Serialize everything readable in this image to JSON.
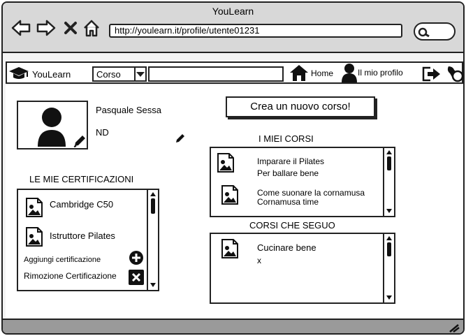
{
  "browser": {
    "title": "YouLearn",
    "url": "http://youlearn.it/profile/utente01231"
  },
  "appbar": {
    "brand": "YouLearn",
    "select_value": "Corso",
    "home_label": "Home",
    "profile_label": "Il mio profilo"
  },
  "profile": {
    "name": "Pasquale Sessa",
    "info": "ND"
  },
  "certifications": {
    "heading": "LE MIE CERTIFICAZIONI",
    "items": [
      {
        "label": "Cambridge C50"
      },
      {
        "label": "Istruttore Pilates"
      }
    ],
    "add_label": "Aggiungi certificazione",
    "remove_label": "Rimozione Certificazione"
  },
  "create_course_button": "Crea un nuovo corso!",
  "my_courses": {
    "heading": "I MIEI CORSI",
    "items": [
      {
        "title": "Imparare il Pilates",
        "subtitle": "Per ballare bene"
      },
      {
        "title": "Come suonare la cornamusa",
        "subtitle": "Cornamusa time"
      }
    ]
  },
  "followed_courses": {
    "heading": "CORSI CHE SEGUO",
    "items": [
      {
        "title": "Cucinare bene",
        "subtitle": "x"
      }
    ]
  },
  "icons": [
    "back-arrow-icon",
    "forward-arrow-icon",
    "close-icon",
    "home-icon",
    "search-icon",
    "graduation-cap-icon",
    "user-icon",
    "logout-icon",
    "notifications-icon",
    "edit-icon",
    "image-icon",
    "plus-icon",
    "remove-icon",
    "resize-icon"
  ]
}
